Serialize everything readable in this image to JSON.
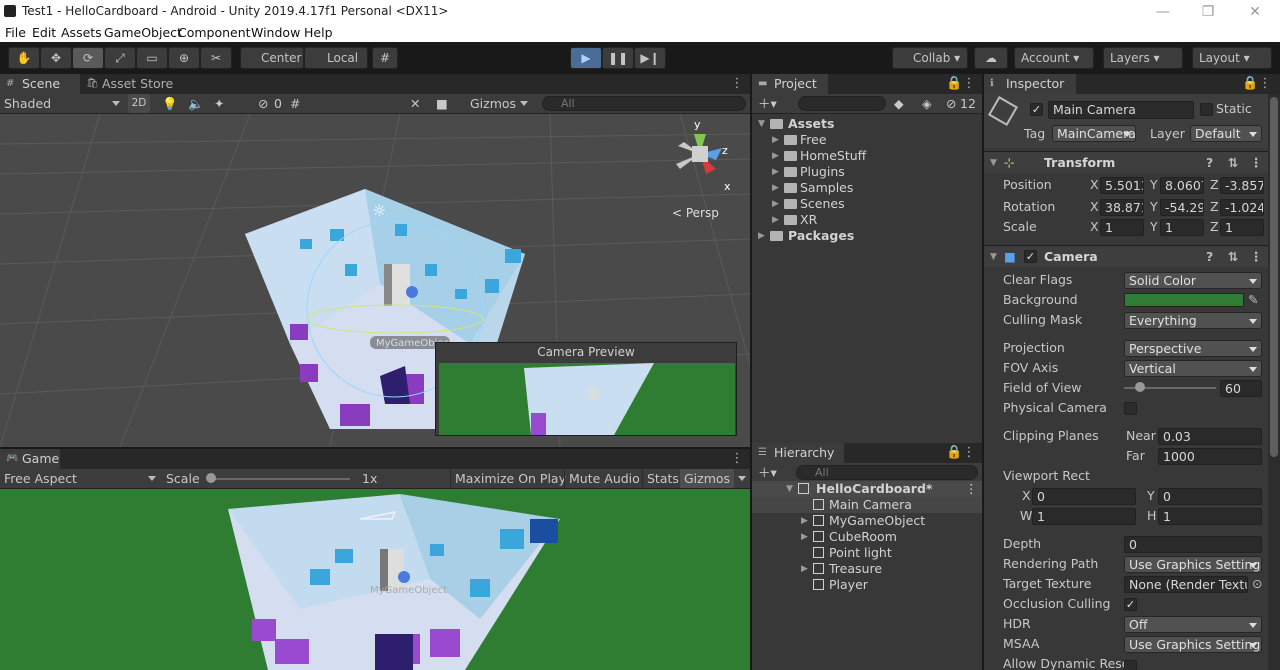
{
  "window": {
    "title": "Test1 - HelloCardboard - Android - Unity 2019.4.17f1 Personal <DX11>",
    "minimize": "—",
    "maximize": "❐",
    "close": "✕"
  },
  "menu": [
    "File",
    "Edit",
    "Assets",
    "GameObject",
    "Component",
    "Window",
    "Help"
  ],
  "toolbar": {
    "tools": [
      "hand-icon",
      "move-icon",
      "rotate-icon",
      "scale-icon",
      "rect-icon",
      "transform-icon",
      "custom-tool-icon"
    ],
    "center": "Center",
    "local": "Local",
    "collab": "Collab",
    "account": "Account",
    "layers": "Layers",
    "layout": "Layout"
  },
  "scene": {
    "tabs": [
      "Scene",
      "Asset Store"
    ],
    "shading": "Shaded",
    "mode2d": "2D",
    "hidden_count": "0",
    "gizmos": "Gizmos",
    "search_placeholder": "All",
    "persp": "< Persp",
    "gizmo_axes": [
      "y",
      "z",
      "x"
    ],
    "object_label": "MyGameObject",
    "camera_preview_title": "Camera Preview"
  },
  "game": {
    "tab": "Game",
    "aspect": "Free Aspect",
    "scale_label": "Scale",
    "scale_value": "1x",
    "buttons": [
      "Maximize On Play",
      "Mute Audio",
      "Stats",
      "Gizmos"
    ],
    "background": "#2e7d32",
    "object_label": "MyGameObject"
  },
  "project": {
    "tab": "Project",
    "hidden_count": "12",
    "tree": [
      {
        "label": "Assets",
        "depth": 0,
        "expanded": true
      },
      {
        "label": "Free",
        "depth": 1,
        "expanded": false
      },
      {
        "label": "HomeStuff",
        "depth": 1,
        "expanded": false
      },
      {
        "label": "Plugins",
        "depth": 1,
        "expanded": false
      },
      {
        "label": "Samples",
        "depth": 1,
        "expanded": false
      },
      {
        "label": "Scenes",
        "depth": 1,
        "expanded": false
      },
      {
        "label": "XR",
        "depth": 1,
        "expanded": false
      },
      {
        "label": "Packages",
        "depth": 0,
        "expanded": false
      }
    ]
  },
  "hierarchy": {
    "tab": "Hierarchy",
    "search_placeholder": "All",
    "scene": "HelloCardboard*",
    "items": [
      {
        "label": "Main Camera",
        "arrow": false,
        "selected": true
      },
      {
        "label": "MyGameObject",
        "arrow": true,
        "selected": false
      },
      {
        "label": "CubeRoom",
        "arrow": true,
        "selected": false
      },
      {
        "label": "Point light",
        "arrow": false,
        "selected": false
      },
      {
        "label": "Treasure",
        "arrow": true,
        "selected": false
      },
      {
        "label": "Player",
        "arrow": false,
        "selected": false
      }
    ]
  },
  "inspector": {
    "tab": "Inspector",
    "name": "Main Camera",
    "static": "Static",
    "tag_label": "Tag",
    "tag": "MainCamera",
    "layer_label": "Layer",
    "layer": "Default",
    "transform": {
      "title": "Transform",
      "position": {
        "label": "Position",
        "x": "5.5013",
        "y": "8.0607",
        "z": "-3.857"
      },
      "rotation": {
        "label": "Rotation",
        "x": "38.871",
        "y": "-54.29",
        "z": "-1.024"
      },
      "scale": {
        "label": "Scale",
        "x": "1",
        "y": "1",
        "z": "1"
      }
    },
    "camera": {
      "title": "Camera",
      "clear_flags": {
        "label": "Clear Flags",
        "value": "Solid Color"
      },
      "background": {
        "label": "Background",
        "color": "#2e7d32"
      },
      "culling_mask": {
        "label": "Culling Mask",
        "value": "Everything"
      },
      "projection": {
        "label": "Projection",
        "value": "Perspective"
      },
      "fov_axis": {
        "label": "FOV Axis",
        "value": "Vertical"
      },
      "fov": {
        "label": "Field of View",
        "value": "60",
        "slider_fraction": 0.17
      },
      "physical": {
        "label": "Physical Camera"
      },
      "clipping": {
        "label": "Clipping Planes",
        "near_label": "Near",
        "near": "0.03",
        "far_label": "Far",
        "far": "1000"
      },
      "viewport": {
        "label": "Viewport Rect",
        "x": "0",
        "y": "0",
        "w": "1",
        "h": "1"
      },
      "depth": {
        "label": "Depth",
        "value": "0"
      },
      "rendering_path": {
        "label": "Rendering Path",
        "value": "Use Graphics Settings"
      },
      "target_texture": {
        "label": "Target Texture",
        "value": "None (Render Texture)"
      },
      "occlusion": {
        "label": "Occlusion Culling"
      },
      "hdr": {
        "label": "HDR",
        "value": "Off"
      },
      "msaa": {
        "label": "MSAA",
        "value": "Use Graphics Settings"
      },
      "dynamic_res": {
        "label": "Allow Dynamic Resolution"
      }
    }
  }
}
